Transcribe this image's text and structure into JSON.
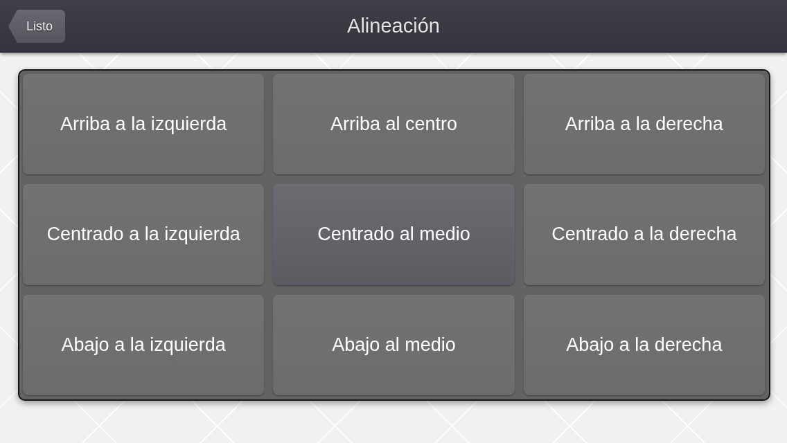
{
  "nav_bar": {
    "back_button": "Listo",
    "title": "Alineación"
  },
  "alignment_grid": [
    {
      "label": "Arriba a la izquierda",
      "selected": false
    },
    {
      "label": "Arriba al centro",
      "selected": false
    },
    {
      "label": "Arriba a la derecha",
      "selected": false
    },
    {
      "label": "Centrado a la izquierda",
      "selected": false
    },
    {
      "label": "Centrado al medio",
      "selected": true
    },
    {
      "label": "Centrado a la derecha",
      "selected": false
    },
    {
      "label": "Abajo a la izquierda",
      "selected": false
    },
    {
      "label": "Abajo al medio",
      "selected": false
    },
    {
      "label": "Abajo a la derecha",
      "selected": false
    }
  ]
}
